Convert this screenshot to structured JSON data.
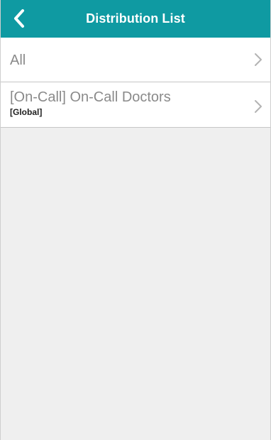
{
  "header": {
    "title": "Distribution List",
    "background_color": "#0f9aa2",
    "back_icon": "chevron-left-icon"
  },
  "list": {
    "items": [
      {
        "label": "All",
        "sublabel": "",
        "icon": "chevron-right-icon"
      },
      {
        "label": "[On-Call] On-Call Doctors",
        "sublabel": "[Global]",
        "icon": "chevron-right-icon"
      }
    ]
  },
  "colors": {
    "label_text": "#8a8a8a",
    "sublabel_text": "#1e1e1e",
    "background": "#efefef",
    "divider": "#c6c6c6"
  }
}
